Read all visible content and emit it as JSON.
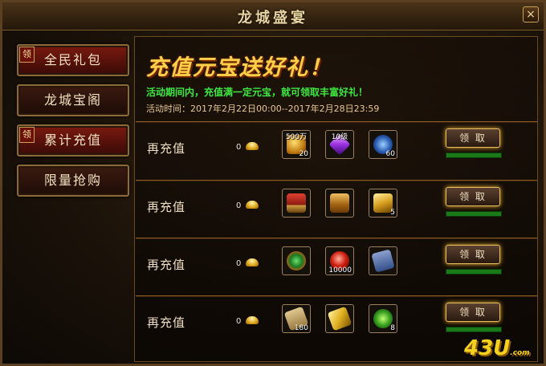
{
  "window": {
    "title": "龙城盛宴",
    "close_icon": "×"
  },
  "sidebar": {
    "items": [
      {
        "label": "全民礼包",
        "badge": "领",
        "active": true
      },
      {
        "label": "龙城宝阁",
        "badge": "",
        "active": false
      },
      {
        "label": "累计充值",
        "badge": "领",
        "active": true
      },
      {
        "label": "限量抢购",
        "badge": "",
        "active": false
      }
    ]
  },
  "main": {
    "banner": "充值元宝送好礼！",
    "description": "活动期间内，充值满一定元宝，就可领取丰富好礼！",
    "time_label": "活动时间：",
    "time_value": "2017年2月22日00:00--2017年2月28日23:59",
    "rows": [
      {
        "label": "再充值",
        "amount": "0",
        "button": "领 取",
        "items": [
          {
            "icon": "gold-chest-icon",
            "top": "500万",
            "qty": "20"
          },
          {
            "icon": "purple-crystal-icon",
            "top": "10级",
            "qty": ""
          },
          {
            "icon": "blue-orb-icon",
            "top": "",
            "qty": "60"
          }
        ]
      },
      {
        "label": "再充值",
        "amount": "0",
        "button": "领 取",
        "items": [
          {
            "icon": "red-treasure-chest-icon",
            "top": "",
            "qty": ""
          },
          {
            "icon": "gold-treasure-chest-icon",
            "top": "",
            "qty": ""
          },
          {
            "icon": "gold-bars-icon",
            "top": "",
            "qty": "5"
          }
        ]
      },
      {
        "label": "再充值",
        "amount": "0",
        "button": "领 取",
        "items": [
          {
            "icon": "green-jade-icon",
            "top": "",
            "qty": ""
          },
          {
            "icon": "red-orb-icon",
            "top": "",
            "qty": "10000"
          },
          {
            "icon": "blue-book-icon",
            "top": "",
            "qty": ""
          }
        ]
      },
      {
        "label": "再充值",
        "amount": "0",
        "button": "领 取",
        "items": [
          {
            "icon": "scroll-icon",
            "top": "",
            "qty": "180"
          },
          {
            "icon": "gold-brick-icon",
            "top": "",
            "qty": ""
          },
          {
            "icon": "green-gear-icon",
            "top": "",
            "qty": "8"
          }
        ]
      }
    ]
  },
  "logo": {
    "text": "43U",
    "suffix": ".com"
  }
}
